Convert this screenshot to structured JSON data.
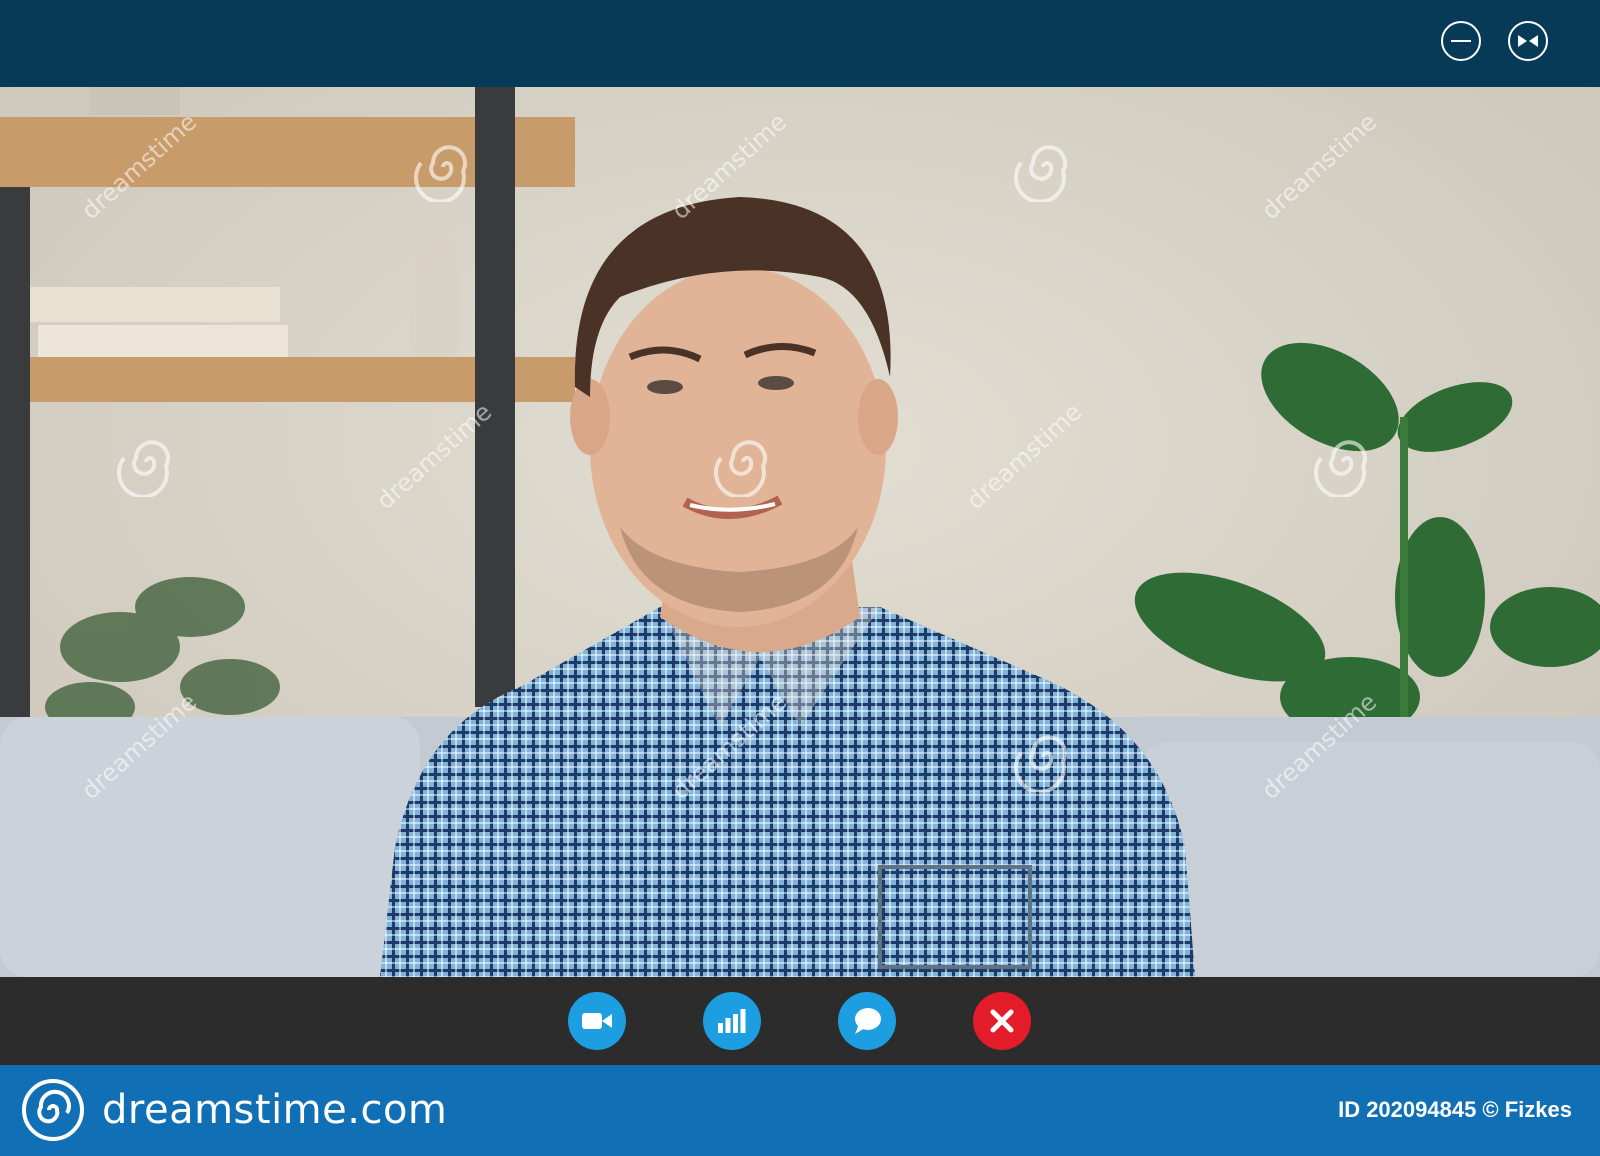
{
  "window": {
    "controls": {
      "minimize_icon": "minimize-icon",
      "fullscreen_icon": "exit-fullscreen-icon"
    },
    "titlebar_color": "#063a56"
  },
  "video": {
    "content": "video-feed"
  },
  "call_controls": {
    "buttons": [
      {
        "icon": "video-camera-icon",
        "color": "#1c9ee0"
      },
      {
        "icon": "signal-bars-icon",
        "color": "#1c9ee0"
      },
      {
        "icon": "chat-bubble-icon",
        "color": "#1c9ee0"
      },
      {
        "icon": "close-icon",
        "color": "#e41c2a"
      }
    ],
    "bar_color": "#2c2c2c"
  },
  "watermark": {
    "text": "dreamstime",
    "logo_icon": "spiral-logo-icon"
  },
  "footer": {
    "brand": "dreamstime.com",
    "credit": "ID 202094845 © Fizkes",
    "color": "#1170b5"
  }
}
